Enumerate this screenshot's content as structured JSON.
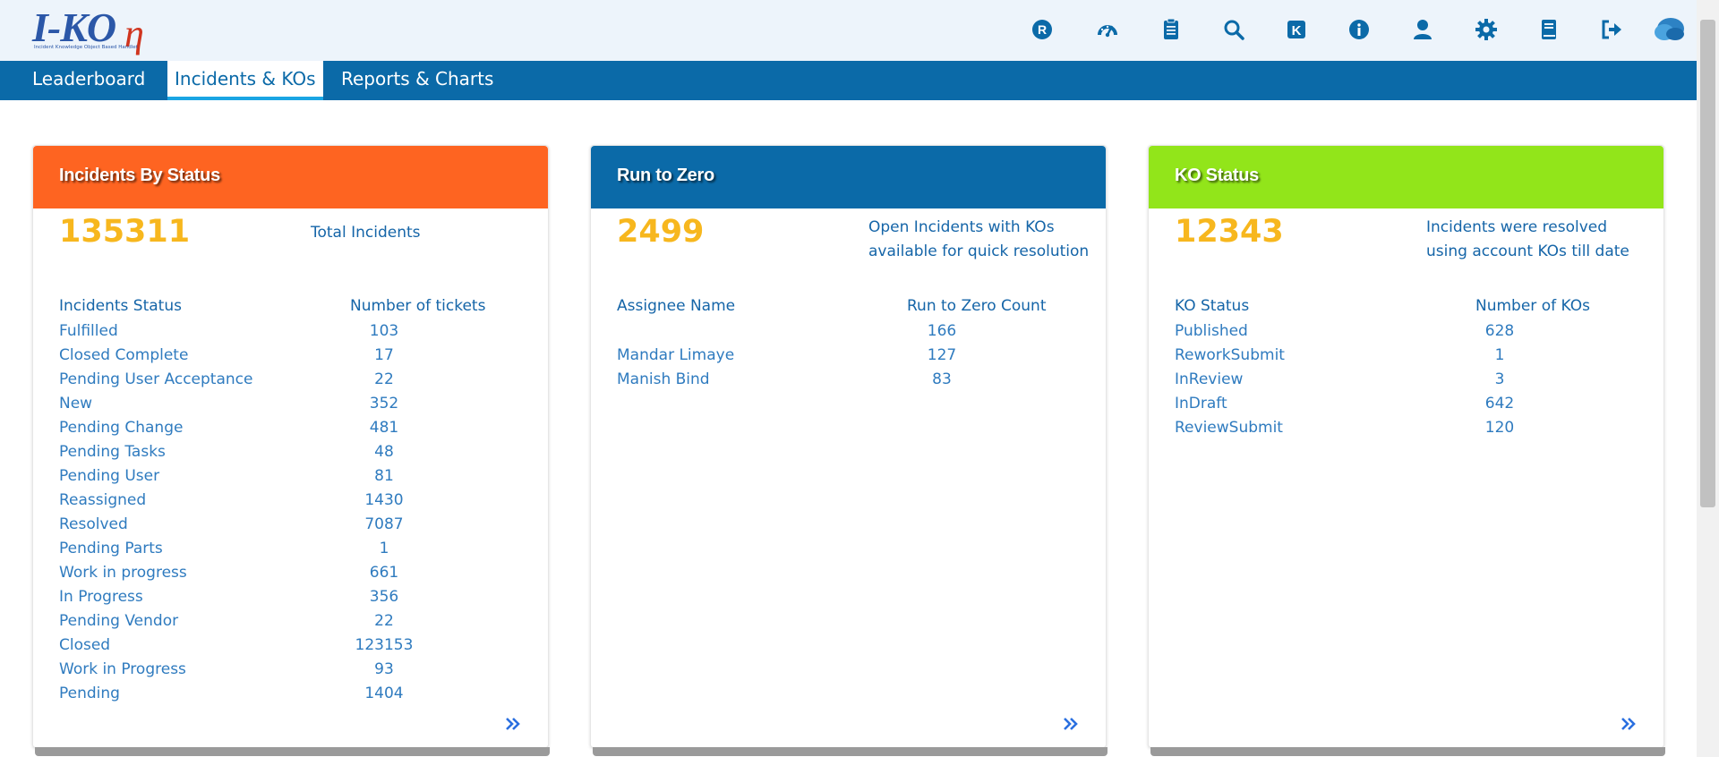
{
  "logo": {
    "main": "I-KO",
    "eta": "η",
    "tagline": "Incident Knowledge Object Based Handlet"
  },
  "header_icons": [
    {
      "name": "r-badge-icon"
    },
    {
      "name": "dashboard-gauge-icon"
    },
    {
      "name": "clipboard-list-icon"
    },
    {
      "name": "search-icon"
    },
    {
      "name": "k-box-icon"
    },
    {
      "name": "info-icon"
    },
    {
      "name": "user-icon"
    },
    {
      "name": "gear-icon"
    },
    {
      "name": "book-icon"
    },
    {
      "name": "sign-out-icon"
    },
    {
      "name": "cloud-avatar-icon"
    }
  ],
  "nav": {
    "tabs": [
      {
        "label": "Leaderboard",
        "active": false
      },
      {
        "label": "Incidents & KOs",
        "active": true
      },
      {
        "label": "Reports & Charts",
        "active": false
      }
    ]
  },
  "colors": {
    "orange": "#fe6421",
    "blue": "#0b6aa8",
    "green": "#92e51a",
    "number": "#f7b71e",
    "text": "#1565a8"
  },
  "cards": [
    {
      "title": "Incidents By Status",
      "big_number": "135311",
      "summary": "Total Incidents",
      "col1": "Incidents Status",
      "col2": "Number of tickets",
      "rows": [
        {
          "label": "Fulfilled",
          "value": "103"
        },
        {
          "label": "Closed Complete",
          "value": "17"
        },
        {
          "label": "Pending User Acceptance",
          "value": "22"
        },
        {
          "label": "New",
          "value": "352"
        },
        {
          "label": "Pending Change",
          "value": "481"
        },
        {
          "label": "Pending Tasks",
          "value": "48"
        },
        {
          "label": "Pending User",
          "value": "81"
        },
        {
          "label": "Reassigned",
          "value": "1430"
        },
        {
          "label": "Resolved",
          "value": "7087"
        },
        {
          "label": "Pending Parts",
          "value": "1"
        },
        {
          "label": "Work in progress",
          "value": "661"
        },
        {
          "label": "In Progress",
          "value": "356"
        },
        {
          "label": "Pending Vendor",
          "value": "22"
        },
        {
          "label": "Closed",
          "value": "123153"
        },
        {
          "label": "Work in Progress",
          "value": "93"
        },
        {
          "label": "Pending",
          "value": "1404"
        }
      ]
    },
    {
      "title": "Run to Zero",
      "big_number": "2499",
      "summary_line1": "Open Incidents with KOs",
      "summary_line2": "available for quick resolution",
      "col1": "Assignee Name",
      "col2": "Run to Zero Count",
      "rows": [
        {
          "label": "",
          "value": "166"
        },
        {
          "label": "Mandar Limaye",
          "value": "127"
        },
        {
          "label": "Manish Bind",
          "value": "83"
        }
      ]
    },
    {
      "title": "KO Status",
      "big_number": "12343",
      "summary_line1": "Incidents were resolved",
      "summary_line2": "using account KOs till date",
      "col1": "KO Status",
      "col2": "Number of KOs",
      "rows": [
        {
          "label": "Published",
          "value": "628"
        },
        {
          "label": "ReworkSubmit",
          "value": "1"
        },
        {
          "label": "InReview",
          "value": "3"
        },
        {
          "label": "InDraft",
          "value": "642"
        },
        {
          "label": "ReviewSubmit",
          "value": "120"
        }
      ]
    }
  ]
}
